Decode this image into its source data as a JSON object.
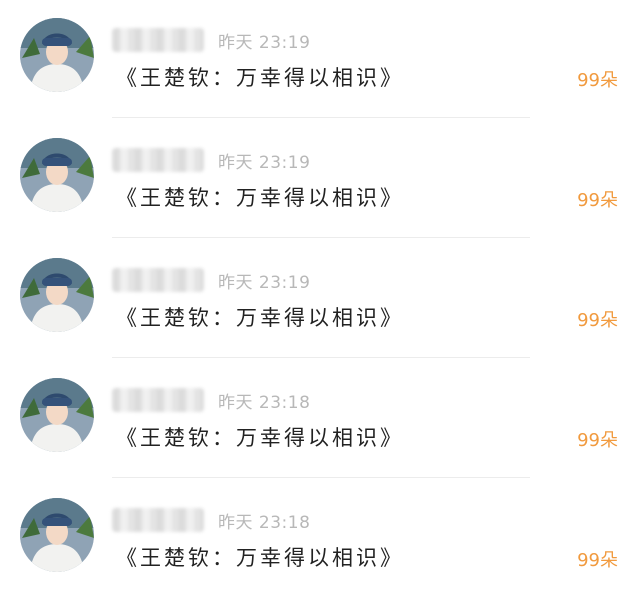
{
  "messages": [
    {
      "time": "昨天 23:19",
      "text": "《王楚钦：万幸得以相识》",
      "gift": "99朵"
    },
    {
      "time": "昨天 23:19",
      "text": "《王楚钦：万幸得以相识》",
      "gift": "99朵"
    },
    {
      "time": "昨天 23:19",
      "text": "《王楚钦：万幸得以相识》",
      "gift": "99朵"
    },
    {
      "time": "昨天 23:18",
      "text": "《王楚钦：万幸得以相识》",
      "gift": "99朵"
    },
    {
      "time": "昨天 23:18",
      "text": "《王楚钦：万幸得以相识》",
      "gift": "99朵"
    }
  ],
  "colors": {
    "gift": "#f19a3e",
    "time": "#b8b8b8",
    "text": "#222222"
  }
}
